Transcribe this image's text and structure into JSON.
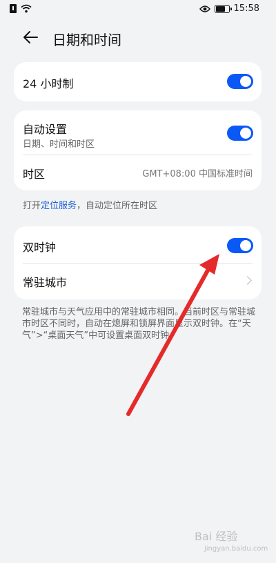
{
  "status_bar": {
    "time": "15:58"
  },
  "header": {
    "title": "日期和时间"
  },
  "card_24h": {
    "label": "24 小时制",
    "toggle_on": true
  },
  "card_auto": {
    "auto_label": "自动设置",
    "auto_sub": "日期、时间和时区",
    "auto_toggle_on": true,
    "timezone_label": "时区",
    "timezone_value": "GMT+08:00 中国标准时间"
  },
  "location_hint": {
    "prefix": "打开",
    "link": "定位服务",
    "suffix": "，自动定位所在时区"
  },
  "card_dual": {
    "dual_label": "双时钟",
    "dual_toggle_on": true,
    "home_city_label": "常驻城市"
  },
  "description": "常驻城市与天气应用中的常驻城市相同。当前时区与常驻城市时区不同时，自动在熄屏和锁屏界面显示双时钟。在“天气”>“桌面天气”中可设置桌面双时钟。",
  "watermark": {
    "text": "Bai 经验",
    "sub": "jingyan.baidu.com"
  },
  "colors": {
    "accent": "#0a59f7",
    "annotation_arrow": "#e52a2a",
    "background": "#f1f3f5"
  }
}
